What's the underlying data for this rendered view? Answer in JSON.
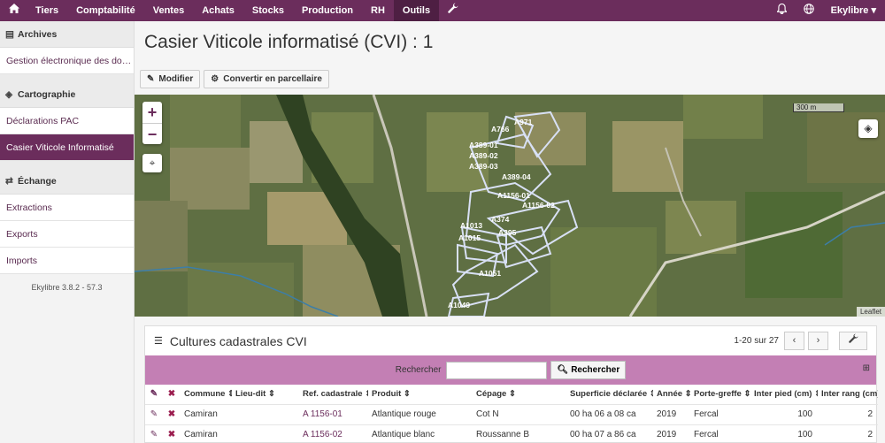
{
  "topnav": {
    "items": [
      "Tiers",
      "Comptabilité",
      "Ventes",
      "Achats",
      "Stocks",
      "Production",
      "RH",
      "Outils"
    ],
    "active": "Outils",
    "user": "Ekylibre"
  },
  "sidebar": {
    "sections": [
      {
        "title": "Archives",
        "items": [
          "Gestion électronique des documents"
        ]
      },
      {
        "title": "Cartographie",
        "items": [
          "Déclarations PAC",
          "Casier Viticole Informatisé"
        ]
      },
      {
        "title": "Échange",
        "items": [
          "Extractions",
          "Exports",
          "Imports"
        ]
      }
    ],
    "version": "Ekylibre 3.8.2 - 57.3"
  },
  "page": {
    "title": "Casier Viticole informatisé (CVI)  : 1",
    "buttons": {
      "edit": "Modifier",
      "convert": "Convertir en parcellaire"
    }
  },
  "map": {
    "scale": "300 m",
    "attribution": "Leaflet",
    "parcels": [
      "A971",
      "A766",
      "A389-01",
      "A389-02",
      "A389-03",
      "A389-04",
      "A1156-01",
      "A1156-02",
      "A1013",
      "A1015",
      "A374",
      "A395",
      "A1051",
      "A1049"
    ]
  },
  "panel": {
    "title": "Cultures cadastrales CVI",
    "pagination": "1-20 sur 27",
    "search_label": "Rechercher",
    "search_value": "",
    "search_button": "Rechercher",
    "columns": [
      "Commune",
      "Lieu-dit",
      "Ref. cadastrale",
      "Produit",
      "Cépage",
      "Superficie déclarée",
      "Année",
      "Porte-greffe",
      "Inter pied (cm)",
      "Inter rang (cm)"
    ],
    "rows": [
      {
        "commune": "Camiran",
        "lieu_dit": "",
        "ref": "A 1156-01",
        "produit": "Atlantique rouge",
        "cepage": "Cot N",
        "superficie": "00 ha 06 a 08 ca",
        "annee": "2019",
        "porte_greffe": "Fercal",
        "inter_pied": "100",
        "inter_rang": "2"
      },
      {
        "commune": "Camiran",
        "lieu_dit": "",
        "ref": "A 1156-02",
        "produit": "Atlantique blanc",
        "cepage": "Roussanne B",
        "superficie": "00 ha 07 a 86 ca",
        "annee": "2019",
        "porte_greffe": "Fercal",
        "inter_pied": "100",
        "inter_rang": "2"
      }
    ]
  },
  "colors": {
    "primary": "#6b2d5c",
    "search_bar": "#c37fb4",
    "parcel_outline": "#cfd8f0"
  }
}
